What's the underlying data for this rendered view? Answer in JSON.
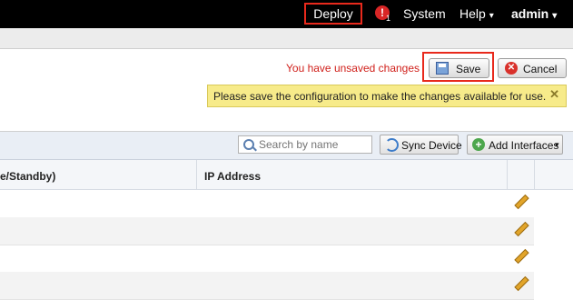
{
  "topbar": {
    "deploy_label": "Deploy",
    "alert_icon_text": "!",
    "alert_count": "1",
    "system_label": "System",
    "help_label": "Help",
    "user_label": "admin",
    "caret": "▾"
  },
  "actions": {
    "unsaved_text": "You have unsaved changes",
    "save_label": "Save",
    "cancel_label": "Cancel"
  },
  "notice": {
    "message": "Please save the configuration to make the changes available for use.",
    "close_symbol": "✕"
  },
  "toolbar": {
    "search_placeholder": "Search by name",
    "sync_label": "Sync Device",
    "add_interfaces_label": "Add Interfaces",
    "add_icon_text": "+"
  },
  "table": {
    "columns": [
      "e/Standby)",
      "IP Address"
    ]
  },
  "colors": {
    "highlight": "#e8291c",
    "unsaved_text": "#d0201b",
    "notice_bg": "#f7eb8a"
  }
}
